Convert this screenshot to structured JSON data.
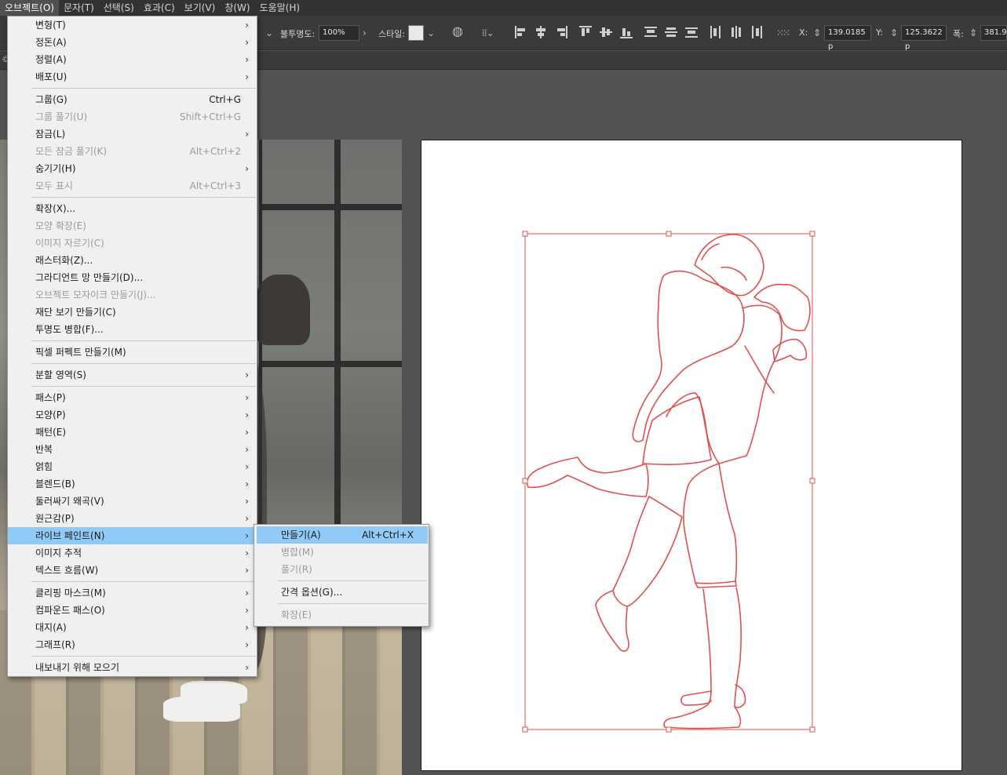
{
  "menubar": {
    "items": [
      "오브젝트(O)",
      "문자(T)",
      "선택(S)",
      "효과(C)",
      "보기(V)",
      "창(W)",
      "도움말(H)"
    ]
  },
  "control_bar": {
    "opacity_label": "불투명도:",
    "opacity_value": "100%",
    "style_label": "스타일:",
    "x_label": "X:",
    "x_value": "139.0185 p",
    "y_label": "Y:",
    "y_value": "125.3622 p",
    "w_label": "폭:",
    "w_value": "381.9"
  },
  "tab_strip": {
    "glyph": "©"
  },
  "object_menu": {
    "items": [
      {
        "label": "변형(T)",
        "shortcut": "",
        "submenu": true,
        "disabled": false
      },
      {
        "label": "정돈(A)",
        "shortcut": "",
        "submenu": true,
        "disabled": false
      },
      {
        "label": "정렬(A)",
        "shortcut": "",
        "submenu": true,
        "disabled": false
      },
      {
        "label": "배포(U)",
        "shortcut": "",
        "submenu": true,
        "disabled": false
      },
      {
        "label": "그룹(G)",
        "shortcut": "Ctrl+G",
        "submenu": false,
        "disabled": false
      },
      {
        "label": "그룹 풀기(U)",
        "shortcut": "Shift+Ctrl+G",
        "submenu": false,
        "disabled": true
      },
      {
        "label": "잠금(L)",
        "shortcut": "",
        "submenu": true,
        "disabled": false
      },
      {
        "label": "모든 잠금 풀기(K)",
        "shortcut": "Alt+Ctrl+2",
        "submenu": false,
        "disabled": true
      },
      {
        "label": "숨기기(H)",
        "shortcut": "",
        "submenu": true,
        "disabled": false
      },
      {
        "label": "모두 표시",
        "shortcut": "Alt+Ctrl+3",
        "submenu": false,
        "disabled": true
      },
      {
        "label": "확장(X)...",
        "shortcut": "",
        "submenu": false,
        "disabled": false
      },
      {
        "label": "모양 확장(E)",
        "shortcut": "",
        "submenu": false,
        "disabled": true
      },
      {
        "label": "이미지 자르기(C)",
        "shortcut": "",
        "submenu": false,
        "disabled": true
      },
      {
        "label": "래스터화(Z)...",
        "shortcut": "",
        "submenu": false,
        "disabled": false
      },
      {
        "label": "그라디언트 망 만들기(D)...",
        "shortcut": "",
        "submenu": false,
        "disabled": false
      },
      {
        "label": "오브젝트 모자이크 만들기(J)...",
        "shortcut": "",
        "submenu": false,
        "disabled": true
      },
      {
        "label": "재단 보기 만들기(C)",
        "shortcut": "",
        "submenu": false,
        "disabled": false
      },
      {
        "label": "투명도 병합(F)...",
        "shortcut": "",
        "submenu": false,
        "disabled": false
      },
      {
        "label": "픽셀 퍼펙트 만들기(M)",
        "shortcut": "",
        "submenu": false,
        "disabled": false
      },
      {
        "label": "분할 영역(S)",
        "shortcut": "",
        "submenu": true,
        "disabled": false
      },
      {
        "label": "패스(P)",
        "shortcut": "",
        "submenu": true,
        "disabled": false
      },
      {
        "label": "모양(P)",
        "shortcut": "",
        "submenu": true,
        "disabled": false
      },
      {
        "label": "패턴(E)",
        "shortcut": "",
        "submenu": true,
        "disabled": false
      },
      {
        "label": "반복",
        "shortcut": "",
        "submenu": true,
        "disabled": false
      },
      {
        "label": "얽힘",
        "shortcut": "",
        "submenu": true,
        "disabled": false
      },
      {
        "label": "블렌드(B)",
        "shortcut": "",
        "submenu": true,
        "disabled": false
      },
      {
        "label": "둘러싸기 왜곡(V)",
        "shortcut": "",
        "submenu": true,
        "disabled": false
      },
      {
        "label": "원근감(P)",
        "shortcut": "",
        "submenu": true,
        "disabled": false
      },
      {
        "label": "라이브 페인트(N)",
        "shortcut": "",
        "submenu": true,
        "disabled": false,
        "highlighted": true
      },
      {
        "label": "이미지 추적",
        "shortcut": "",
        "submenu": true,
        "disabled": false
      },
      {
        "label": "텍스트 흐름(W)",
        "shortcut": "",
        "submenu": true,
        "disabled": false
      },
      {
        "label": "클리핑 마스크(M)",
        "shortcut": "",
        "submenu": true,
        "disabled": false
      },
      {
        "label": "컴파운드 패스(O)",
        "shortcut": "",
        "submenu": true,
        "disabled": false
      },
      {
        "label": "대지(A)",
        "shortcut": "",
        "submenu": true,
        "disabled": false
      },
      {
        "label": "그래프(R)",
        "shortcut": "",
        "submenu": true,
        "disabled": false
      },
      {
        "label": "내보내기 위해 모으기",
        "shortcut": "",
        "submenu": true,
        "disabled": false
      }
    ]
  },
  "live_paint_submenu": {
    "items": [
      {
        "label": "만들기(A)",
        "shortcut": "Alt+Ctrl+X",
        "disabled": false,
        "highlighted": true
      },
      {
        "label": "병합(M)",
        "shortcut": "",
        "disabled": true
      },
      {
        "label": "풀기(R)",
        "shortcut": "",
        "disabled": true
      },
      {
        "label": "간격 옵션(G)...",
        "shortcut": "",
        "disabled": false
      },
      {
        "label": "확장(E)",
        "shortcut": "",
        "disabled": true
      }
    ]
  },
  "colors": {
    "menu_highlight": "#91c9f7",
    "outline_stroke": "#e0504e",
    "workspace": "#535353",
    "artboard": "#ffffff"
  }
}
